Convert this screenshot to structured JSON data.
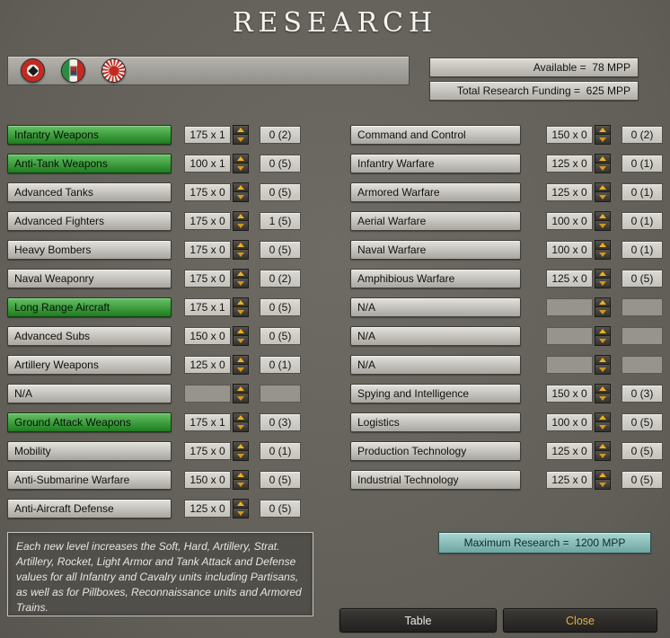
{
  "title": "RESEARCH",
  "header": {
    "available": "Available =  78 MPP",
    "funding": "Total Research Funding =  625 MPP",
    "flags": [
      "german-flag",
      "italian-flag",
      "japanese-flag"
    ]
  },
  "left_rows": [
    {
      "label": "Infantry Weapons",
      "cost": "175 x 1",
      "level": "0 (2)",
      "active": true,
      "na": false
    },
    {
      "label": "Anti-Tank Weapons",
      "cost": "100 x 1",
      "level": "0 (5)",
      "active": true,
      "na": false
    },
    {
      "label": "Advanced Tanks",
      "cost": "175 x 0",
      "level": "0 (5)",
      "active": false,
      "na": false
    },
    {
      "label": "Advanced Fighters",
      "cost": "175 x 0",
      "level": "1 (5)",
      "active": false,
      "na": false
    },
    {
      "label": "Heavy Bombers",
      "cost": "175 x 0",
      "level": "0 (5)",
      "active": false,
      "na": false
    },
    {
      "label": "Naval Weaponry",
      "cost": "175 x 0",
      "level": "0 (2)",
      "active": false,
      "na": false
    },
    {
      "label": "Long Range Aircraft",
      "cost": "175 x 1",
      "level": "0 (5)",
      "active": true,
      "na": false
    },
    {
      "label": "Advanced Subs",
      "cost": "150 x 0",
      "level": "0 (5)",
      "active": false,
      "na": false
    },
    {
      "label": "Artillery Weapons",
      "cost": "125 x 0",
      "level": "0 (1)",
      "active": false,
      "na": false
    },
    {
      "label": "N/A",
      "cost": "",
      "level": "",
      "active": false,
      "na": true
    },
    {
      "label": "Ground Attack Weapons",
      "cost": "175 x 1",
      "level": "0 (3)",
      "active": true,
      "na": false
    },
    {
      "label": "Mobility",
      "cost": "175 x 0",
      "level": "0 (1)",
      "active": false,
      "na": false
    },
    {
      "label": "Anti-Submarine Warfare",
      "cost": "150 x 0",
      "level": "0 (5)",
      "active": false,
      "na": false
    },
    {
      "label": "Anti-Aircraft Defense",
      "cost": "125 x 0",
      "level": "0 (5)",
      "active": false,
      "na": false
    }
  ],
  "right_rows": [
    {
      "label": "Command and Control",
      "cost": "150 x 0",
      "level": "0 (2)",
      "active": false,
      "na": false
    },
    {
      "label": "Infantry Warfare",
      "cost": "125 x 0",
      "level": "0 (1)",
      "active": false,
      "na": false
    },
    {
      "label": "Armored Warfare",
      "cost": "125 x 0",
      "level": "0 (1)",
      "active": false,
      "na": false
    },
    {
      "label": "Aerial Warfare",
      "cost": "100 x 0",
      "level": "0 (1)",
      "active": false,
      "na": false
    },
    {
      "label": "Naval Warfare",
      "cost": "100 x 0",
      "level": "0 (1)",
      "active": false,
      "na": false
    },
    {
      "label": "Amphibious Warfare",
      "cost": "125 x 0",
      "level": "0 (5)",
      "active": false,
      "na": false
    },
    {
      "label": "N/A",
      "cost": "",
      "level": "",
      "active": false,
      "na": true
    },
    {
      "label": "N/A",
      "cost": "",
      "level": "",
      "active": false,
      "na": true
    },
    {
      "label": "N/A",
      "cost": "",
      "level": "",
      "active": false,
      "na": true
    },
    {
      "label": "Spying and Intelligence",
      "cost": "150 x 0",
      "level": "0 (3)",
      "active": false,
      "na": false
    },
    {
      "label": "Logistics",
      "cost": "100 x 0",
      "level": "0 (5)",
      "active": false,
      "na": false
    },
    {
      "label": "Production Technology",
      "cost": "125 x 0",
      "level": "0 (5)",
      "active": false,
      "na": false
    },
    {
      "label": "Industrial Technology",
      "cost": "125 x 0",
      "level": "0 (5)",
      "active": false,
      "na": false
    }
  ],
  "description": "Each new level increases the Soft, Hard, Artillery, Strat. Artillery, Rocket, Light Armor and Tank Attack and Defense values for all Infantry and Cavalry units including Partisans, as well as for Pillboxes, Reconnaissance units and Armored Trains.",
  "maximum": "Maximum Research =  1200 MPP",
  "buttons": {
    "table": "Table",
    "close": "Close"
  },
  "colors": {
    "background": "#615e57",
    "active_green": "#2e8b2e",
    "maximum_teal": "#8cbcb8",
    "close_gold": "#e3b33c",
    "spinner_gold": "#f0b01c"
  }
}
